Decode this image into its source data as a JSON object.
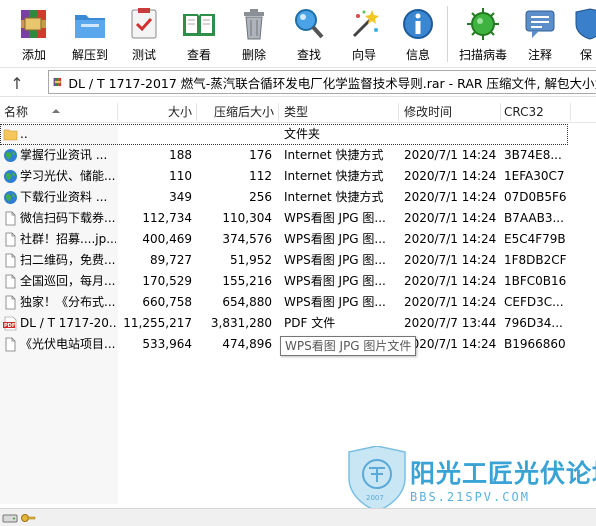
{
  "toolbar": {
    "buttons": [
      {
        "label": "添加",
        "icon": "add-archive-icon"
      },
      {
        "label": "解压到",
        "icon": "extract-to-icon"
      },
      {
        "label": "测试",
        "icon": "test-icon"
      },
      {
        "label": "查看",
        "icon": "view-icon"
      },
      {
        "label": "删除",
        "icon": "delete-icon"
      },
      {
        "label": "查找",
        "icon": "find-icon"
      },
      {
        "label": "向导",
        "icon": "wizard-icon"
      },
      {
        "label": "信息",
        "icon": "info-icon"
      },
      {
        "label": "扫描病毒",
        "icon": "virus-scan-icon"
      },
      {
        "label": "注释",
        "icon": "comment-icon"
      },
      {
        "label": "保",
        "icon": "protect-icon"
      }
    ]
  },
  "address": {
    "text": "DL / T 1717-2017  燃气-蒸汽联合循环发电厂化学监督技术导则.rar - RAR 压缩文件, 解包大小为"
  },
  "columns": {
    "name": "名称",
    "size": "大小",
    "packed": "压缩后大小",
    "type": "类型",
    "modified": "修改时间",
    "crc": "CRC32"
  },
  "rows": [
    {
      "name": "..",
      "size": "",
      "packed": "",
      "type": "文件夹",
      "modified": "",
      "crc": "",
      "icon": "folder-icon"
    },
    {
      "name": "掌握行业资讯 ...",
      "size": "188",
      "packed": "176",
      "type": "Internet 快捷方式",
      "modified": "2020/7/1 14:24",
      "crc": "3B74E8...",
      "icon": "internet-shortcut-icon"
    },
    {
      "name": "学习光伏、储能...",
      "size": "110",
      "packed": "112",
      "type": "Internet 快捷方式",
      "modified": "2020/7/1 14:24",
      "crc": "1EFA30C7",
      "icon": "internet-shortcut-icon"
    },
    {
      "name": "下载行业资料 ...",
      "size": "349",
      "packed": "256",
      "type": "Internet 快捷方式",
      "modified": "2020/7/1 14:24",
      "crc": "07D0B5F6",
      "icon": "internet-shortcut-icon"
    },
    {
      "name": "微信扫码下载券...",
      "size": "112,734",
      "packed": "110,304",
      "type": "WPS看图 JPG 图...",
      "modified": "2020/7/1 14:24",
      "crc": "B7AAB3...",
      "icon": "image-file-icon"
    },
    {
      "name": "社群！招募....jp...",
      "size": "400,469",
      "packed": "374,576",
      "type": "WPS看图 JPG 图...",
      "modified": "2020/7/1 14:24",
      "crc": "E5C4F79B",
      "icon": "image-file-icon"
    },
    {
      "name": "扫二维码，免费...",
      "size": "89,727",
      "packed": "51,952",
      "type": "WPS看图 JPG 图...",
      "modified": "2020/7/1 14:24",
      "crc": "1F8DB2CF",
      "icon": "image-file-icon"
    },
    {
      "name": "全国巡回，每月...",
      "size": "170,529",
      "packed": "155,216",
      "type": "WPS看图 JPG 图...",
      "modified": "2020/7/1 14:24",
      "crc": "1BFC0B16",
      "icon": "image-file-icon"
    },
    {
      "name": "独家！《分布式...",
      "size": "660,758",
      "packed": "654,880",
      "type": "WPS看图 JPG 图...",
      "modified": "2020/7/1 14:24",
      "crc": "CEFD3C...",
      "icon": "image-file-icon"
    },
    {
      "name": "DL / T 1717-20...",
      "size": "11,255,217",
      "packed": "3,831,280",
      "type": "PDF 文件",
      "modified": "2020/7/7 13:44",
      "crc": "796D34...",
      "icon": "pdf-file-icon"
    },
    {
      "name": "《光伏电站项目...",
      "size": "533,964",
      "packed": "474,896",
      "type": "WPS看图 JPG 图...",
      "modified": "2020/7/1 14:24",
      "crc": "B1966860",
      "icon": "image-file-icon"
    }
  ],
  "tooltip": "WPS看图 JPG 图片文件",
  "watermark": {
    "title": "阳光工匠光伏论坛",
    "url": "BBS.21SPV.COM",
    "year": "2007"
  },
  "colors": {
    "accent": "#3aa3d6",
    "selection_outline": "#333333"
  }
}
